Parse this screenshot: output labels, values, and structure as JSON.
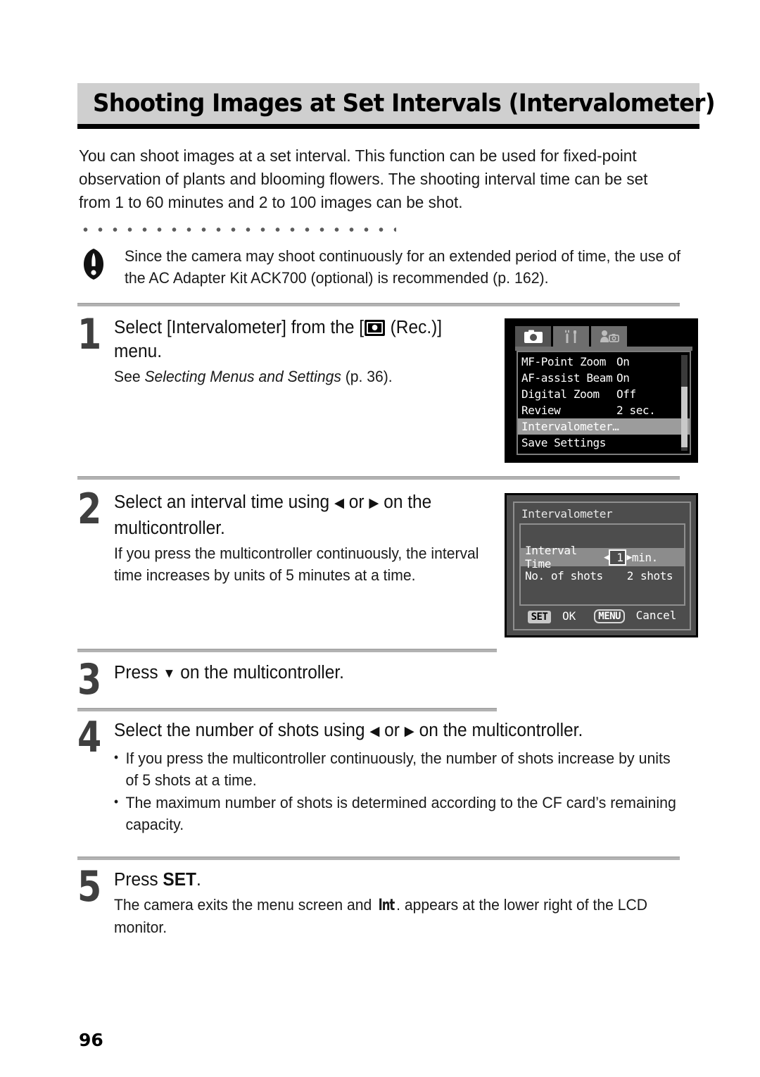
{
  "header": {
    "title": "Shooting Images at Set Intervals (Intervalometer)"
  },
  "intro": {
    "paragraph": "You can shoot images at a set interval. This function can be used for fixed-point observation of plants and blooming flowers. The shooting interval time can be set from 1 to 60 minutes and 2 to 100 images can be shot."
  },
  "caution": {
    "icon": "exclamation-icon",
    "text": "Since the camera may shoot continuously for an extended period of time, the use of the AC Adapter Kit ACK700 (optional) is recommended (p. 162)."
  },
  "steps": [
    {
      "number": "1",
      "head_before": "Select [Intervalometer] from the [",
      "head_icon": "rec-camera-icon",
      "head_after": " (Rec.)] menu.",
      "sub_prefix": "See ",
      "sub_italic": "Selecting Menus and Settings",
      "sub_suffix": " (p. 36)."
    },
    {
      "number": "2",
      "head_before": "Select an interval time using ",
      "head_left_arrow": "◀",
      "head_mid": " or ",
      "head_right_arrow": "▶",
      "head_after": " on the multicontroller.",
      "sub": "If you press the multicontroller continuously, the interval time increases by units of 5 minutes at a time."
    },
    {
      "number": "3",
      "head_before": "Press ",
      "head_arrow": "▼",
      "head_after": " on the multicontroller."
    },
    {
      "number": "4",
      "head_before": "Select the number of shots using ",
      "head_left_arrow": "◀",
      "head_mid": " or ",
      "head_right_arrow": "▶",
      "head_after": " on the multicontroller.",
      "bullets": [
        "If you press the multicontroller continuously, the number of shots increase by units of 5 shots at a time.",
        "The maximum number of shots is determined according to the CF card’s remaining capacity."
      ]
    },
    {
      "number": "5",
      "head_before": "Press ",
      "head_bold": "SET",
      "head_after": ".",
      "sub_before": "The camera exits the menu screen and ",
      "sub_icon_text": "Int",
      "sub_after": ". appears at the lower right of the LCD monitor."
    }
  ],
  "lcd_menu": {
    "tabs": [
      {
        "name": "rec-tab",
        "icon": "camera-icon",
        "active": true
      },
      {
        "name": "setup-tab",
        "icon": "wrench-screwdriver-icon",
        "active": false
      },
      {
        "name": "my-camera-tab",
        "icon": "my-camera-icon",
        "active": false
      }
    ],
    "rows": [
      {
        "label": "MF-Point Zoom",
        "value": "On",
        "selected": false
      },
      {
        "label": "AF-assist Beam",
        "value": "On",
        "selected": false
      },
      {
        "label": "Digital Zoom",
        "value": "Off",
        "selected": false
      },
      {
        "label": "Review",
        "value": "2 sec.",
        "selected": false
      },
      {
        "label": "Intervalometer…",
        "value": "",
        "selected": true
      },
      {
        "label": "Save Settings",
        "value": "",
        "selected": false
      }
    ]
  },
  "lcd_dialog": {
    "title": "Intervalometer",
    "rows": [
      {
        "label": "Interval Time",
        "left_arrow": "◀",
        "value": "1",
        "right_arrow": "▶",
        "unit": "min.",
        "selected": true
      },
      {
        "label": "No. of shots",
        "value": "2",
        "unit": "shots",
        "selected": false
      }
    ],
    "footer": {
      "set_key": "SET",
      "set_label": "OK",
      "menu_key": "MENU",
      "menu_label": "Cancel"
    }
  },
  "footer": {
    "page_number": "96"
  },
  "colors": {
    "header_band": "#cfcfcf",
    "rule": "#b2b2b2",
    "step_number": "#3f3f3f",
    "lcd_selected": "#9c9c9c",
    "lcd_bg": "#4d4d4d"
  }
}
